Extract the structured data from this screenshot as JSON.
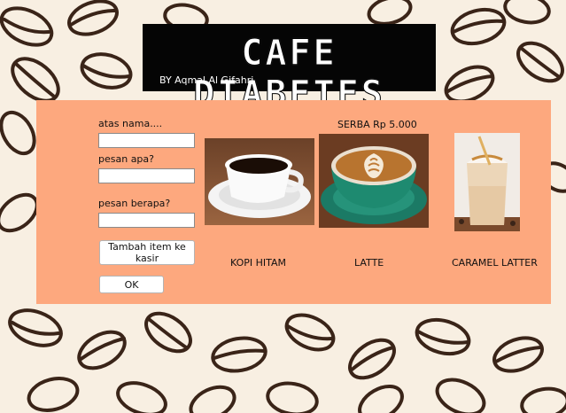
{
  "header": {
    "title": "CAFE DIABETES",
    "subtitle": "BY Aqmal Al Gifahri"
  },
  "form": {
    "name_label": "atas nama....",
    "name_value": "",
    "item_label": "pesan apa?",
    "item_value": "",
    "qty_label": "pesan berapa?",
    "qty_value": "",
    "add_button": "Tambah item ke kasir",
    "ok_button": "OK"
  },
  "menu": {
    "price_note": "SERBA Rp 5.000",
    "items": [
      {
        "name": "KOPI HITAM",
        "image": "black-coffee-cup"
      },
      {
        "name": "LATTE",
        "image": "latte-art-cup"
      },
      {
        "name": "CARAMEL LATTER",
        "image": "caramel-latte-glass"
      }
    ]
  },
  "colors": {
    "panel": "#fda87e",
    "banner": "#050505",
    "wallpaper": "#f8efe2",
    "bean": "#3a2418"
  }
}
